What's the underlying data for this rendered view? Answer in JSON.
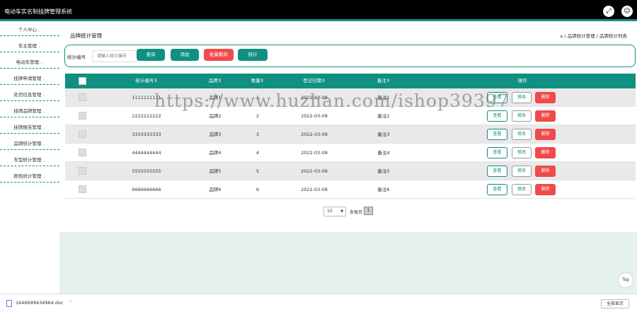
{
  "app": {
    "title": "电动车实名制挂牌管理系统"
  },
  "topbar": {
    "fullscreen_icon": "expand-icon",
    "user_icon": "user-icon"
  },
  "sidebar": {
    "items": [
      {
        "label": "个人中心"
      },
      {
        "label": "车主管理"
      },
      {
        "label": "电动车管理"
      },
      {
        "label": "挂牌申请管理"
      },
      {
        "label": "处罚信息管理"
      },
      {
        "label": "挂牌品牌管理"
      },
      {
        "label": "挂牌报告管理"
      },
      {
        "label": "品牌统计管理"
      },
      {
        "label": "车型统计管理"
      },
      {
        "label": "颜色统计管理"
      }
    ]
  },
  "page": {
    "title": "品牌统计管理",
    "breadcrumb": "/ 品牌统计管理 / 品牌统计列表"
  },
  "search": {
    "label": "统计编号",
    "placeholder": "请输入统计编号",
    "query_label": "查询",
    "add_label": "添加",
    "batch_delete_label": "批量删除",
    "stats_label": "统计"
  },
  "table": {
    "columns": [
      "统计编号",
      "品牌",
      "数量",
      "登记日期",
      "备注",
      "操作"
    ],
    "rows": [
      {
        "id": "1111111111",
        "brand": "品牌1",
        "count": "1",
        "date": "2022-03-08",
        "note": "备注1"
      },
      {
        "id": "2222222222",
        "brand": "品牌2",
        "count": "2",
        "date": "2022-03-08",
        "note": "备注2"
      },
      {
        "id": "3333333333",
        "brand": "品牌3",
        "count": "3",
        "date": "2022-03-08",
        "note": "备注3"
      },
      {
        "id": "4444444444",
        "brand": "品牌4",
        "count": "4",
        "date": "2022-03-08",
        "note": "备注4"
      },
      {
        "id": "5555555555",
        "brand": "品牌5",
        "count": "5",
        "date": "2022-03-08",
        "note": "备注5"
      },
      {
        "id": "6666666666",
        "brand": "品牌6",
        "count": "6",
        "date": "2022-03-08",
        "note": "备注6"
      }
    ],
    "actions": {
      "view": "查看",
      "edit": "修改",
      "delete": "删除"
    }
  },
  "pager": {
    "page_size": "10",
    "per_page_text": "条每页",
    "current_page": "1"
  },
  "watermark": "https://www.huzhan.com/ishop39397",
  "top_button": "Top",
  "download_bar": {
    "file_name": "1646699434964.doc",
    "show_all": "全部显示"
  },
  "colors": {
    "accent": "#0f9080",
    "danger": "#f04a4a",
    "topbar": "#000000"
  }
}
